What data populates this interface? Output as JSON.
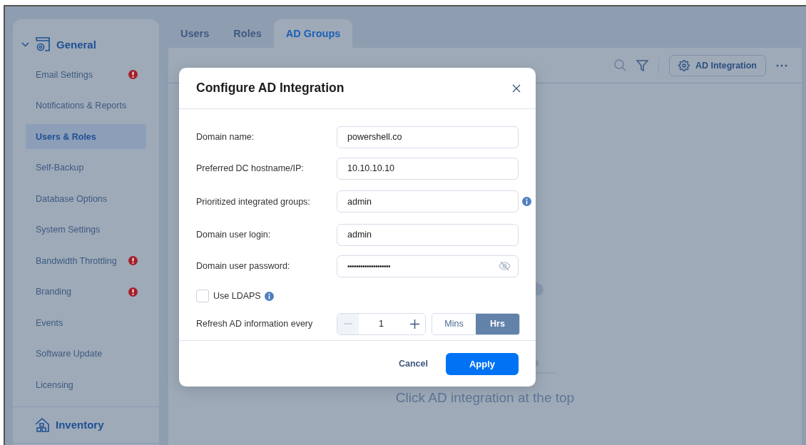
{
  "sidebar": {
    "sections": [
      {
        "title": "General",
        "expanded": true,
        "items": [
          {
            "label": "Email Settings",
            "alert": true,
            "selected": false
          },
          {
            "label": "Notifications & Reports",
            "alert": false,
            "selected": false
          },
          {
            "label": "Users & Roles",
            "alert": false,
            "selected": true
          },
          {
            "label": "Self-Backup",
            "alert": false,
            "selected": false
          },
          {
            "label": "Database Options",
            "alert": false,
            "selected": false
          },
          {
            "label": "System Settings",
            "alert": false,
            "selected": false
          },
          {
            "label": "Bandwidth Throttling",
            "alert": true,
            "selected": false
          },
          {
            "label": "Branding",
            "alert": true,
            "selected": false
          },
          {
            "label": "Events",
            "alert": false,
            "selected": false
          },
          {
            "label": "Software Update",
            "alert": false,
            "selected": false
          },
          {
            "label": "Licensing",
            "alert": false,
            "selected": false
          }
        ]
      },
      {
        "title": "Inventory"
      }
    ]
  },
  "tabs": [
    {
      "label": "Users",
      "selected": false
    },
    {
      "label": "Roles",
      "selected": false
    },
    {
      "label": "AD Groups",
      "selected": true
    }
  ],
  "toolbar": {
    "button": "AD Integration"
  },
  "empty_state": {
    "text": "Click AD integration at the top"
  },
  "dialog": {
    "title": "Configure AD Integration",
    "fields": [
      {
        "kind": "text",
        "label": "Domain name:",
        "value": "powershell.co"
      },
      {
        "kind": "text",
        "label": "Preferred DC hostname/IP:",
        "value": "10.10.10.10"
      },
      {
        "kind": "text",
        "label": "Prioritized integrated groups:",
        "value": "admin",
        "info": true
      },
      {
        "kind": "text",
        "label": "Domain user login:",
        "value": "admin"
      },
      {
        "kind": "password",
        "label": "Domain user password:",
        "value": "••••••••••••••••••••"
      },
      {
        "kind": "checkbox",
        "label": "Use LDAPS",
        "checked": false,
        "info": true
      },
      {
        "kind": "stepper",
        "label": "Refresh AD information every",
        "value": "1",
        "units": [
          {
            "label": "Mins",
            "selected": false
          },
          {
            "label": "Hrs",
            "selected": true
          }
        ]
      }
    ],
    "buttons": {
      "cancel": "Cancel",
      "apply": "Apply"
    }
  }
}
